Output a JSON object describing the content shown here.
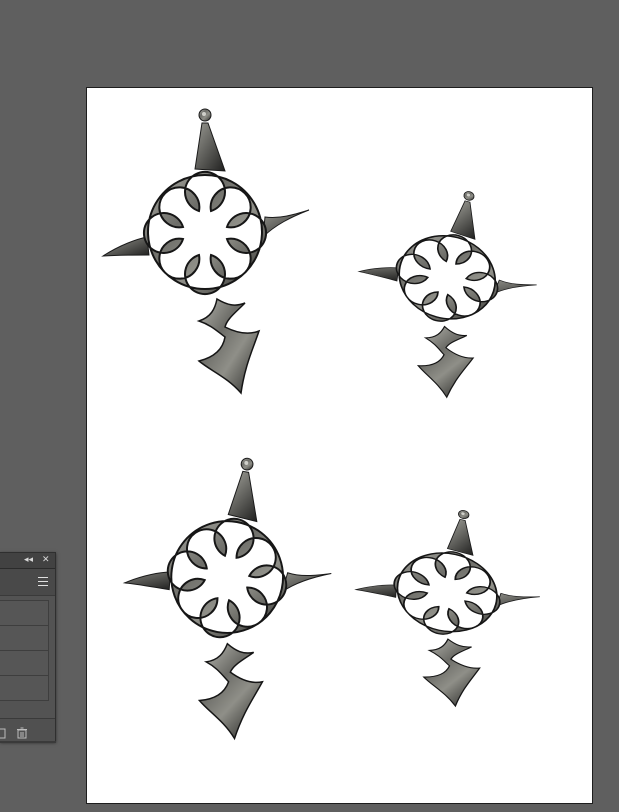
{
  "colors": {
    "workspace_bg": "#5f5f5f",
    "artboard_bg": "#ffffff",
    "metal_dark": "#2e2e2c",
    "metal_light": "#a9a9a2",
    "panel_bg": "#535353"
  },
  "artboard": {
    "artwork": [
      {
        "name": "ornament-top-left",
        "rotation_deg": 0
      },
      {
        "name": "ornament-top-right",
        "rotation_deg": 15
      },
      {
        "name": "ornament-bottom-left",
        "rotation_deg": 10
      },
      {
        "name": "ornament-bottom-right",
        "rotation_deg": 12
      }
    ]
  },
  "panel": {
    "collapse_icon": "double-chevron-left-icon",
    "close_icon": "close-icon",
    "menu_icon": "hamburger-menu-icon",
    "row_count": 4,
    "footer_icons": [
      "new-layer-icon",
      "trash-icon"
    ]
  }
}
